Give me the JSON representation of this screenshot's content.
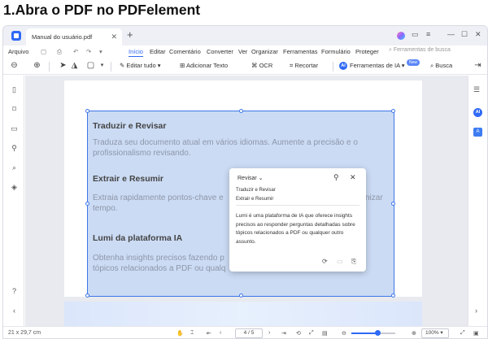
{
  "heading": "1.Abra o PDF no PDFelement",
  "tabbar": {
    "tab_title": "Manual do usuário.pdf",
    "close": "✕",
    "new_tab": "+",
    "window_controls": [
      "—",
      "☐",
      "✕"
    ],
    "right_icons": [
      "⚙",
      "≡"
    ]
  },
  "menu": {
    "items": [
      "Arquivo",
      "Início",
      "Editar",
      "Comentário",
      "Converter",
      "Ver",
      "Organizar",
      "Ferramentas",
      "Formulário",
      "Proteger"
    ],
    "active": "Início",
    "search_placeholder": "Ferramentas de busca"
  },
  "toolbar": {
    "edit_all": "Editar tudo",
    "add_text": "Adicionar Texto",
    "ocr": "OCR",
    "crop": "Recortar",
    "ai_tools": "Ferramentas de IA",
    "new_badge": "New",
    "search": "Busca",
    "ai_letter": "AI"
  },
  "page": {
    "section1_title": "Traduzir e Revisar",
    "section1_text_1": "Traduza seu documento atual em vários idiomas. Aumente a precisão e o",
    "section1_text_2": "profissionalismo revisando.",
    "section2_title": "Extrair e Resumir",
    "section2_text_1": "Extraia rapidamente pontos-chave e",
    "section2_text_1b": "nizar",
    "section2_text_2": "tempo.",
    "section3_title": "Lumi da plataforma IA",
    "section3_text_1": "Obtenha insights precisos fazendo p",
    "section3_text_2": "tópicos relacionados a PDF ou qualq"
  },
  "popup": {
    "title": "Revisar",
    "option1": "Traduzir e Revisar",
    "option2": "Extrair e Resumir",
    "body": "Lumi é uma plataforma de IA que oferece insights precisos ao responder perguntas detalhadas sobre tópicos relacionados a PDF ou qualquer outro assunto."
  },
  "status": {
    "page_size": "21 x 29,7 cm",
    "page_indicator": "4 / 5",
    "zoom": "100%",
    "zoom_fraction": 0.6
  },
  "colors": {
    "accent": "#2f6af5",
    "selection": "#a0beeb"
  }
}
